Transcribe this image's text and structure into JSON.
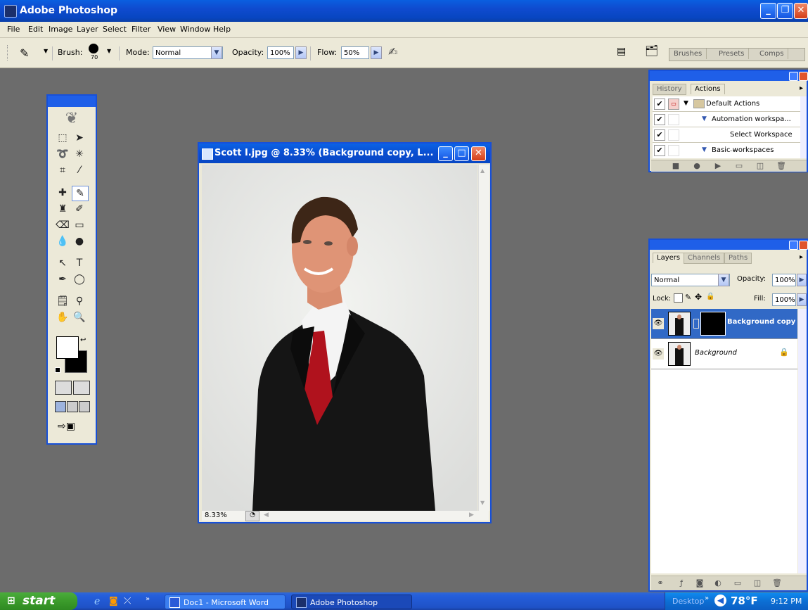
{
  "app": {
    "title": "Adobe Photoshop"
  },
  "menu": [
    "File",
    "Edit",
    "Image",
    "Layer",
    "Select",
    "Filter",
    "View",
    "Window",
    "Help"
  ],
  "options": {
    "brush_label": "Brush:",
    "brush_size": "70",
    "mode_label": "Mode:",
    "mode_value": "Normal",
    "opacity_label": "Opacity:",
    "opacity_value": "100%",
    "flow_label": "Flow:",
    "flow_value": "50%",
    "well_tabs": [
      "Brushes",
      "Presets",
      "Comps"
    ]
  },
  "document": {
    "title": "Scott I.jpg @ 8.33% (Background copy, L...",
    "zoom": "8.33%"
  },
  "actions_panel": {
    "tabs": [
      "History",
      "Actions"
    ],
    "active_tab": "Actions",
    "items": [
      "Default Actions",
      "Automation workspa...",
      "Select Workspace ...",
      "Basic workspaces"
    ]
  },
  "layers_panel": {
    "tabs": [
      "Layers",
      "Channels",
      "Paths"
    ],
    "blend_mode": "Normal",
    "opacity_label": "Opacity:",
    "opacity_value": "100%",
    "lock_label": "Lock:",
    "fill_label": "Fill:",
    "fill_value": "100%",
    "layers": [
      {
        "name": "Background copy",
        "selected": true
      },
      {
        "name": "Background",
        "locked": true
      }
    ]
  },
  "taskbar": {
    "start_label": "start",
    "tasks": [
      "Doc1 - Microsoft Word",
      "Adobe Photoshop"
    ],
    "desktop_label": "Desktop",
    "temperature": "78°F",
    "clock": "9:12 PM"
  },
  "colors": {
    "xp_blue": "#0a5fe0",
    "workspace_gray": "#6c6c6c",
    "panel_bg": "#ece9d8",
    "selected_layer": "#3169c6",
    "start_green": "#3b9b2b"
  }
}
